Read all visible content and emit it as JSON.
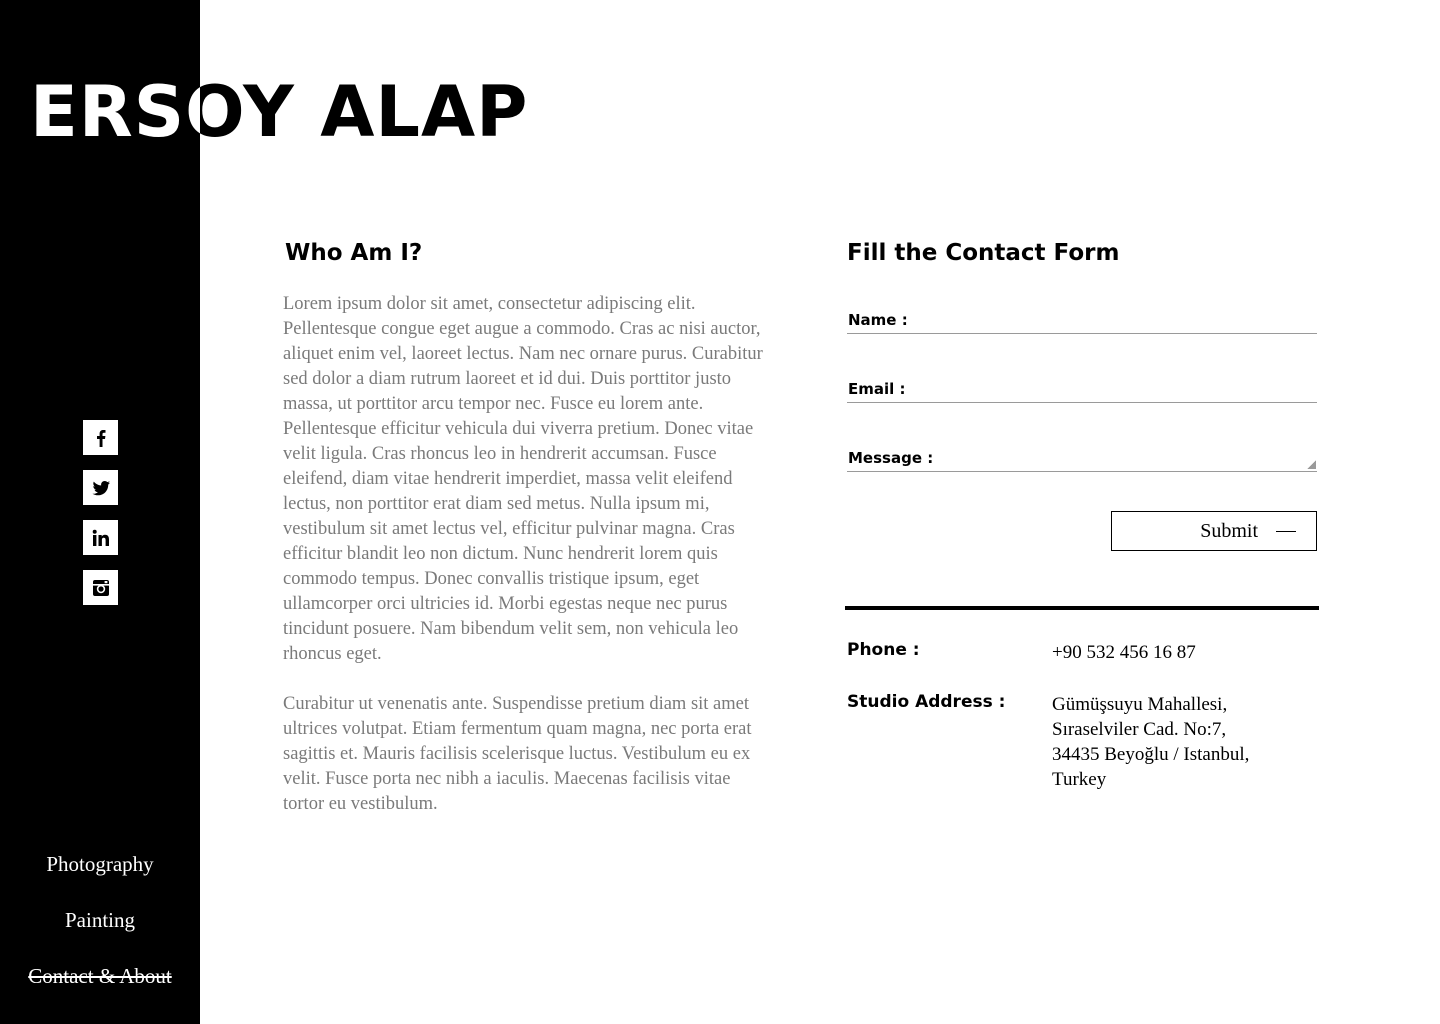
{
  "brand": {
    "name": "ERSOY ALAP"
  },
  "social": [
    "facebook-icon",
    "twitter-icon",
    "linkedin-icon",
    "instagram-icon"
  ],
  "nav": {
    "items": [
      {
        "label": "Photography",
        "active": false
      },
      {
        "label": "Painting",
        "active": false
      },
      {
        "label": "Contact & About",
        "active": true
      }
    ]
  },
  "about": {
    "title": "Who Am I?",
    "paragraphs": [
      "Lorem ipsum dolor sit amet, consectetur adipiscing elit. Pellentesque congue eget augue a commodo. Cras ac nisi auctor, aliquet enim vel, laoreet lectus. Nam nec ornare purus. Curabitur sed dolor a diam rutrum laoreet et id dui. Duis porttitor justo massa, ut porttitor arcu tempor nec. Fusce eu lorem ante. Pellentesque efficitur vehicula dui viverra pretium. Donec vitae velit ligula. Cras rhoncus leo in hendrerit accumsan. Fusce eleifend, diam vitae hendrerit imperdiet, massa velit eleifend lectus, non porttitor erat diam sed metus. Nulla ipsum mi, vestibulum sit amet lectus vel, efficitur pulvinar magna. Cras efficitur blandit leo non dictum. Nunc hendrerit lorem quis commodo tempus. Donec convallis tristique ipsum, eget ullamcorper orci ultricies id. Morbi egestas neque nec purus tincidunt posuere. Nam bibendum velit sem, non vehicula leo rhoncus eget.",
      "Curabitur ut venenatis ante. Suspendisse pretium diam sit amet ultrices volutpat. Etiam fermentum quam magna, nec porta erat sagittis et. Mauris facilisis scelerisque luctus. Vestibulum eu ex velit. Fusce porta nec nibh a iaculis. Maecenas facilisis vitae tortor eu vestibulum."
    ]
  },
  "contact_form": {
    "title": "Fill the Contact Form",
    "name_label": "Name :",
    "name_value": "",
    "email_label": "Email :",
    "email_value": "",
    "message_label": "Message :",
    "message_value": "",
    "submit_label": "Submit"
  },
  "info": {
    "phone_label": "Phone :",
    "phone_value": "+90 532 456 16 87",
    "address_label": "Studio Address :",
    "address_lines": [
      "Gümüşsuyu Mahallesi,",
      "Sıraselviler Cad. No:7,",
      "34435 Beyoğlu / Istanbul,",
      "Turkey"
    ]
  }
}
